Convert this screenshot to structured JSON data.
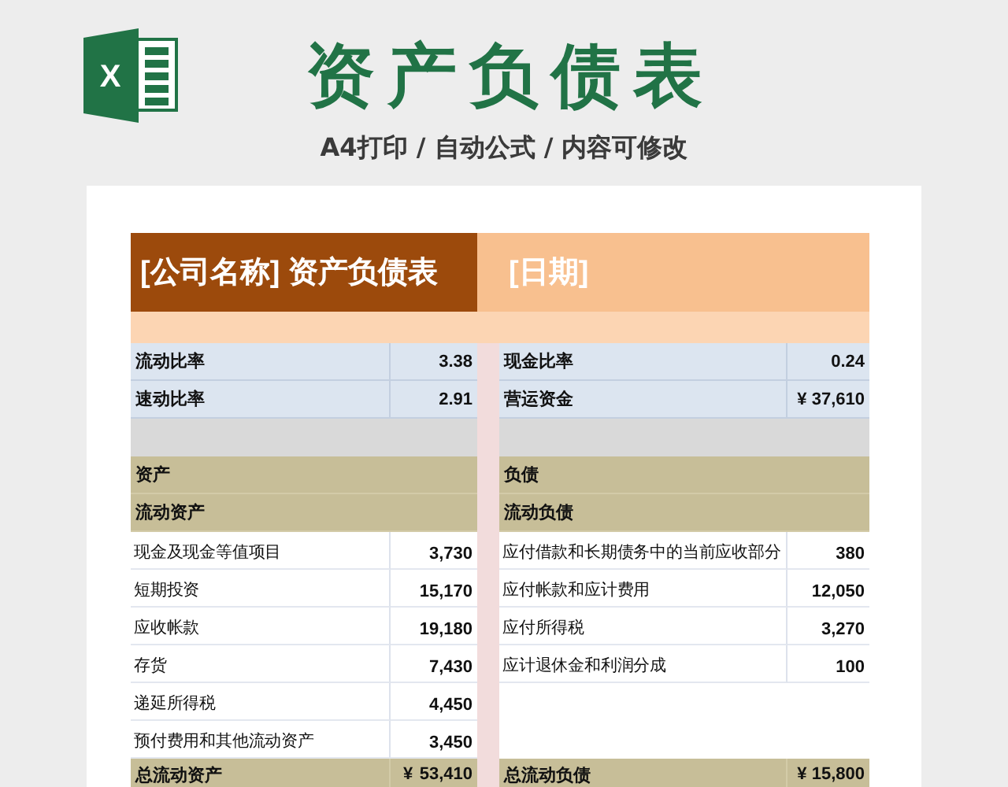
{
  "header": {
    "logo_letter": "X",
    "title": "资产负债表",
    "subtitle": "A4打印 / 自动公式 / 内容可修改"
  },
  "sheet": {
    "company_title": "[公司名称] 资产负债表",
    "date": "[日期]",
    "ratios": [
      {
        "left_label": "流动比率",
        "left_value": "3.38",
        "right_label": "现金比率",
        "right_value": "0.24"
      },
      {
        "left_label": "速动比率",
        "left_value": "2.91",
        "right_label": "营运资金",
        "right_value": "¥ 37,610"
      }
    ],
    "assets": {
      "heading": "资产",
      "subheading": "流动资产",
      "rows": [
        {
          "label": "现金及现金等值项目",
          "value": "3,730"
        },
        {
          "label": "短期投资",
          "value": "15,170"
        },
        {
          "label": "应收帐款",
          "value": "19,180"
        },
        {
          "label": "存货",
          "value": "7,430"
        },
        {
          "label": "递延所得税",
          "value": "4,450"
        },
        {
          "label": "预付费用和其他流动资产",
          "value": "3,450"
        }
      ],
      "total": {
        "label": "总流动资产",
        "currency": "¥",
        "value": "53,410"
      }
    },
    "liabilities": {
      "heading": "负债",
      "subheading": "流动负债",
      "rows": [
        {
          "label": "应付借款和长期债务中的当前应收部分",
          "value": "380"
        },
        {
          "label": "应付帐款和应计费用",
          "value": "12,050"
        },
        {
          "label": "应付所得税",
          "value": "3,270"
        },
        {
          "label": "应计退休金和利润分成",
          "value": "100"
        }
      ],
      "total": {
        "label": "总流动负债",
        "value": "¥ 15,800"
      }
    }
  }
}
